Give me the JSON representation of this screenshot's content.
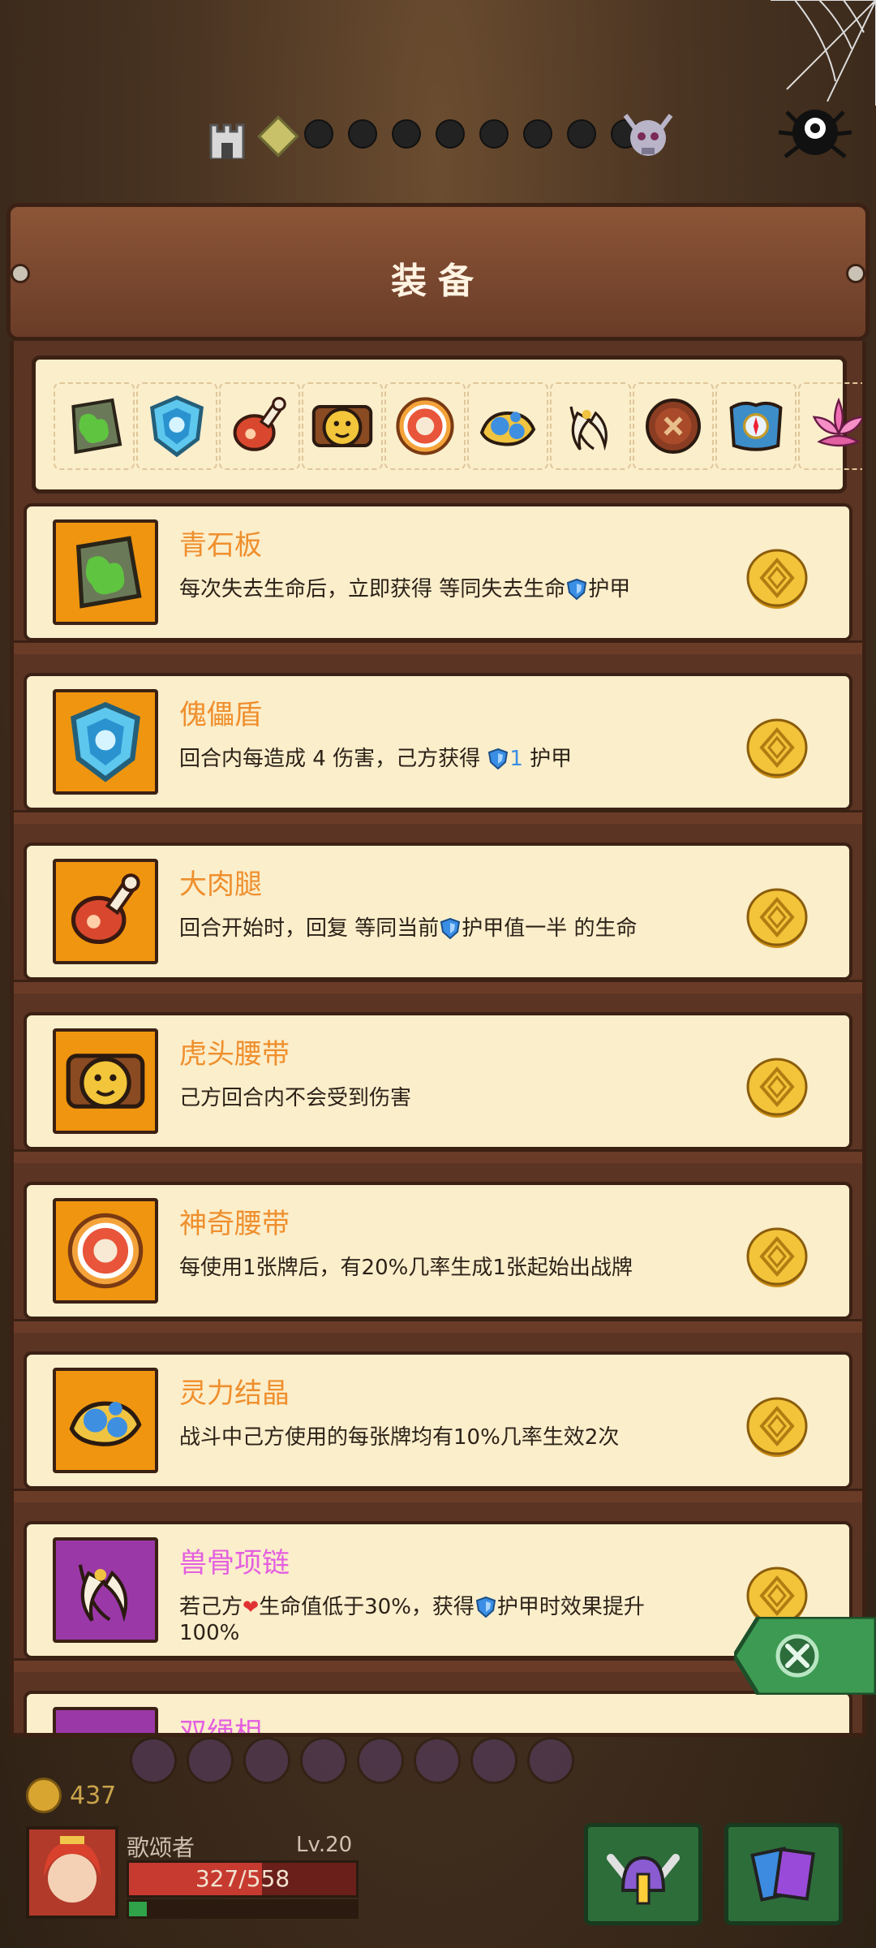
{
  "header": {
    "title": "装备"
  },
  "progress": {
    "dots_total": 8,
    "current": "diamond"
  },
  "strip_icons": [
    "stone-slab-icon",
    "puppet-shield-icon",
    "drumstick-icon",
    "tiger-belt-icon",
    "magic-belt-icon",
    "spirit-crystal-icon",
    "bone-necklace-icon",
    "button-icon",
    "compass-armor-icon",
    "lotus-icon"
  ],
  "cards": [
    {
      "name": "青石板",
      "desc_parts": [
        "每次失去生命后，立即获得 等同失去生命",
        "shield",
        "护甲"
      ],
      "color": "orange",
      "icon": "stone-slab-icon"
    },
    {
      "name": "傀儡盾",
      "desc_parts": [
        "回合内每造成 4 伤害，己方获得 ",
        "shield",
        "1",
        " 护甲"
      ],
      "color": "orange",
      "icon": "puppet-shield-icon"
    },
    {
      "name": "大肉腿",
      "desc_parts": [
        "回合开始时，回复 等同当前",
        "shield",
        "护甲值一半 的生命"
      ],
      "color": "orange",
      "icon": "drumstick-icon"
    },
    {
      "name": "虎头腰带",
      "desc_parts": [
        "己方回合内不会受到伤害"
      ],
      "color": "orange",
      "icon": "tiger-belt-icon"
    },
    {
      "name": "神奇腰带",
      "desc_parts": [
        "每使用1张牌后，有20%几率生成1张起始出战牌"
      ],
      "color": "orange",
      "icon": "magic-belt-icon"
    },
    {
      "name": "灵力结晶",
      "desc_parts": [
        "战斗中己方使用的每张牌均有10%几率生效2次"
      ],
      "color": "orange",
      "icon": "spirit-crystal-icon"
    },
    {
      "name": "兽骨项链",
      "desc_parts": [
        "若己方",
        "heart",
        "生命值低于30%，获得",
        "shield",
        "护甲时效果提升100%"
      ],
      "color": "purple",
      "icon": "bone-necklace-icon"
    },
    {
      "name": "双绳相",
      "desc_parts": [
        ""
      ],
      "color": "purple",
      "icon": "unknown-icon"
    }
  ],
  "player": {
    "gold": "437",
    "name": "歌颂者",
    "level": "Lv.20",
    "hp": "327/558",
    "hp_fraction": 0.586,
    "xp_fraction": 0.08
  },
  "colors": {
    "orange_name": "#ef8f2d",
    "purple_name": "#e45fe0",
    "card_bg": "#fbeecb"
  }
}
